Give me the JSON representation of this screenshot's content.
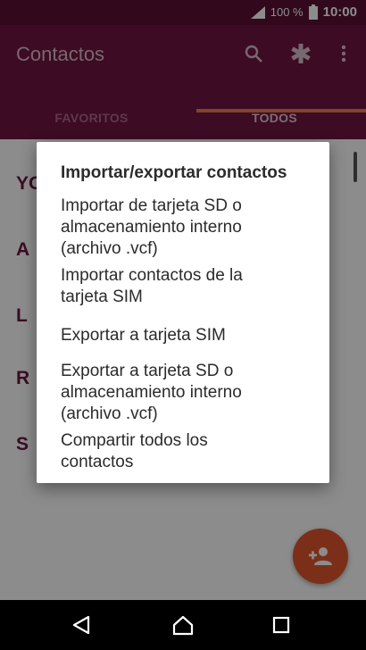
{
  "status_bar": {
    "battery": "100 %",
    "time": "10:00",
    "icons": [
      "signal-icon",
      "battery-icon"
    ]
  },
  "app_bar": {
    "title": "Contactos",
    "icons": [
      "search-icon",
      "asterisk-icon",
      "more-vert-icon"
    ]
  },
  "tabs": [
    {
      "label": "FAVORITOS",
      "selected": false
    },
    {
      "label": "TODOS",
      "selected": true
    }
  ],
  "background_list": {
    "section_letters": [
      "YO",
      "A",
      "L",
      "R",
      "S"
    ]
  },
  "fab": {
    "icon": "add-person-icon"
  },
  "dialog": {
    "title": "Importar/exportar contactos",
    "options": [
      "Importar de tarjeta SD o\nalmacenamiento interno\n(archivo .vcf)",
      "Importar contactos de la\ntarjeta SIM",
      "Exportar a tarjeta SIM",
      "Exportar a tarjeta SD o\nalmacenamiento interno\n(archivo .vcf)",
      "Compartir todos los\ncontactos"
    ]
  },
  "nav_bar": {
    "icons": [
      "back-icon",
      "home-icon",
      "recents-icon"
    ]
  },
  "colors": {
    "app_bar": "#6f1441",
    "status_bar": "#5a0f33",
    "accent": "#e97c53",
    "fab": "#e2562d"
  }
}
